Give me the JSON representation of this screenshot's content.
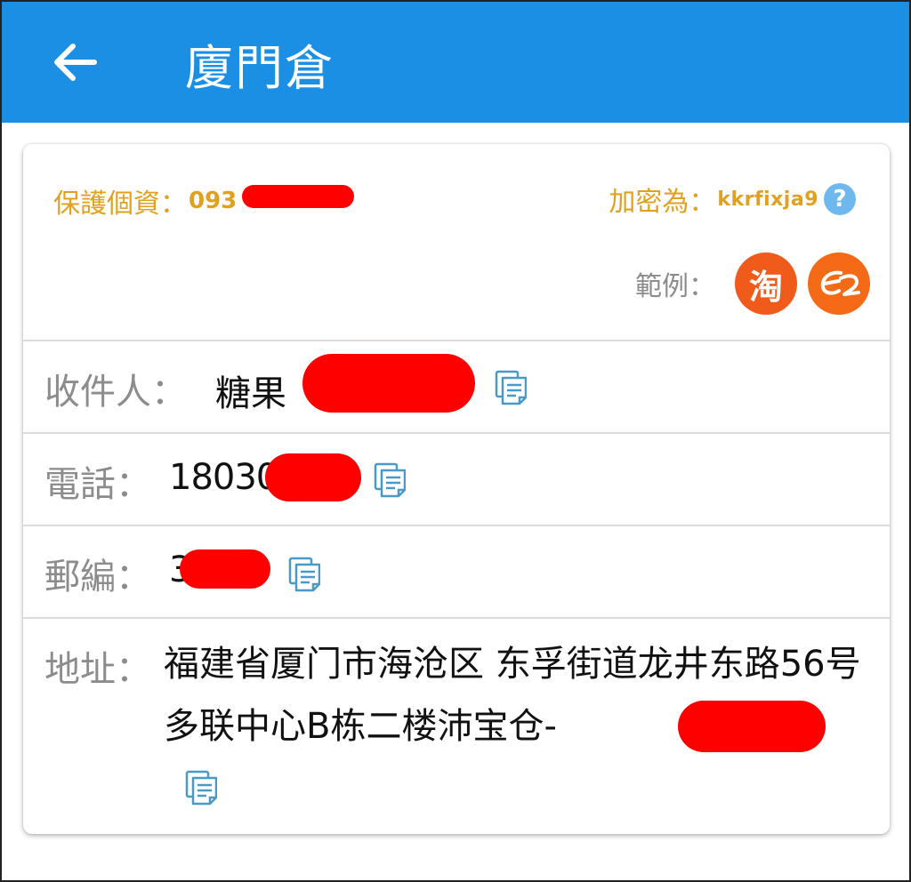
{
  "appbar": {
    "back_icon": "arrow-left-icon",
    "title": "廈門倉"
  },
  "privacy": {
    "protect_label": "保護個資：",
    "protect_value_visible": "093",
    "encrypt_label": "加密為：",
    "encrypt_value": "kkrfixja9",
    "help_glyph": "?",
    "examples_label": "範例：",
    "taobao_glyph": "淘",
    "colors": {
      "accent": "#e0a020",
      "help": "#6fb8ee",
      "taobao": "#f05a1a",
      "alibaba": "#f56a16"
    }
  },
  "fields": {
    "recipient": {
      "label": "收件人：",
      "value_visible": "糖果"
    },
    "phone": {
      "label": "電話：",
      "value_visible": "180300"
    },
    "postcode": {
      "label": "郵編：",
      "value_visible": "3"
    },
    "address": {
      "label": "地址：",
      "value_visible": "福建省厦门市海沧区 东孚街道龙井东路56号多联中心B栋二楼沛宝仓-"
    }
  },
  "colors": {
    "appbar": "#1a8fe3",
    "redaction": "#ff0000",
    "copy_icon": "#4a9ac8",
    "label": "#8c8c8c"
  }
}
